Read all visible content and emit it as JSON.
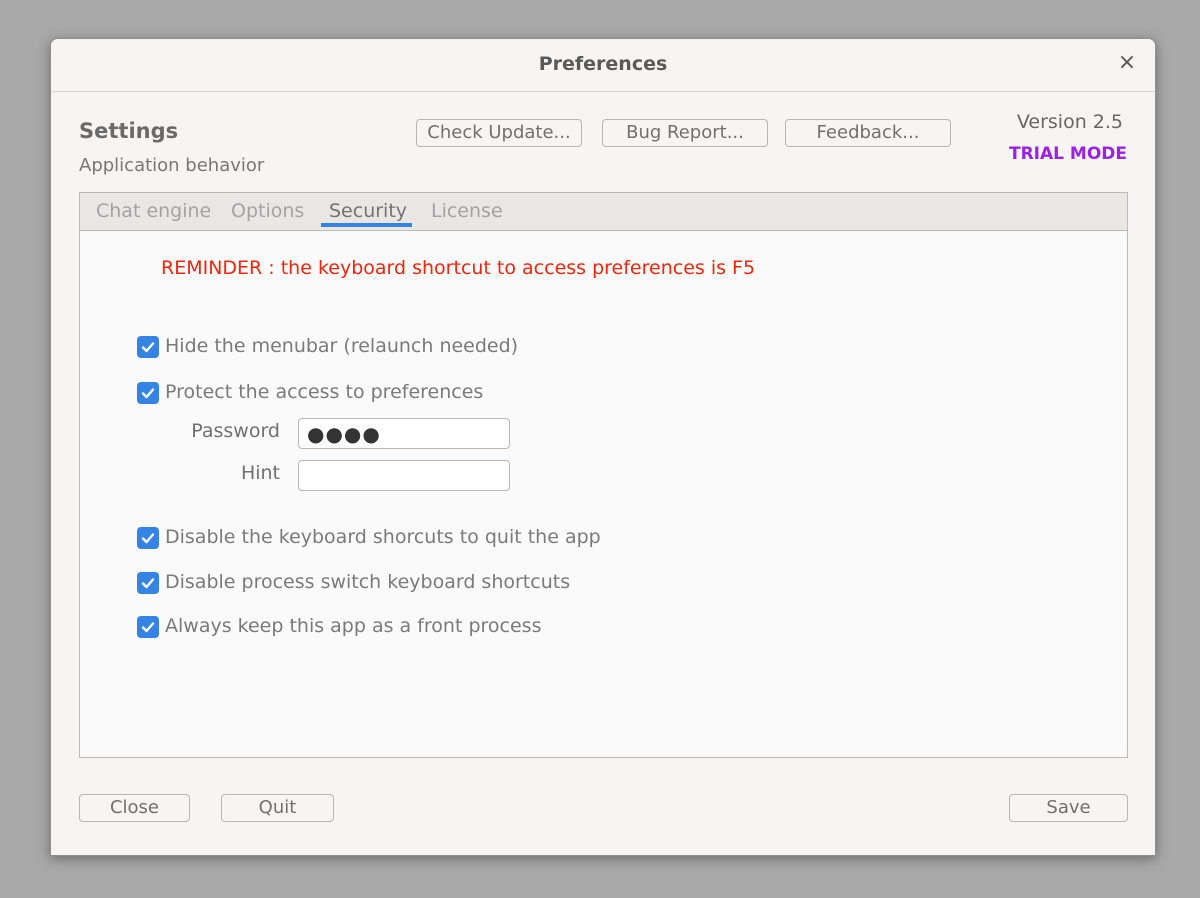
{
  "window": {
    "title": "Preferences",
    "close_glyph": "×"
  },
  "header": {
    "title": "Settings",
    "subtitle": "Application behavior",
    "version": "Version 2.5",
    "mode": "TRIAL MODE",
    "mode_color": "#9b21e8"
  },
  "toolbar": {
    "check_update_label": "Check Update...",
    "bug_report_label": "Bug Report...",
    "feedback_label": "Feedback..."
  },
  "tabs": [
    {
      "label": "Chat engine",
      "active": false
    },
    {
      "label": "Options",
      "active": false
    },
    {
      "label": "Security",
      "active": true
    },
    {
      "label": "License",
      "active": false
    }
  ],
  "security": {
    "reminder": "REMINDER : the keyboard shortcut to access preferences is F5",
    "reminder_color": "#f0260c",
    "options": [
      {
        "label": "Hide the menubar (relaunch needed)",
        "checked": true
      },
      {
        "label": "Protect the access to preferences",
        "checked": true
      },
      {
        "label": "Disable the keyboard shorcuts to quit the app",
        "checked": true
      },
      {
        "label": "Disable process switch keyboard shortcuts",
        "checked": true
      },
      {
        "label": "Always keep this app as a front process",
        "checked": true
      }
    ],
    "password_label": "Password",
    "password_value": "●●●●",
    "hint_label": "Hint",
    "hint_value": ""
  },
  "footer": {
    "close_label": "Close",
    "quit_label": "Quit",
    "save_label": "Save"
  },
  "colors": {
    "accent": "#3584e4"
  }
}
